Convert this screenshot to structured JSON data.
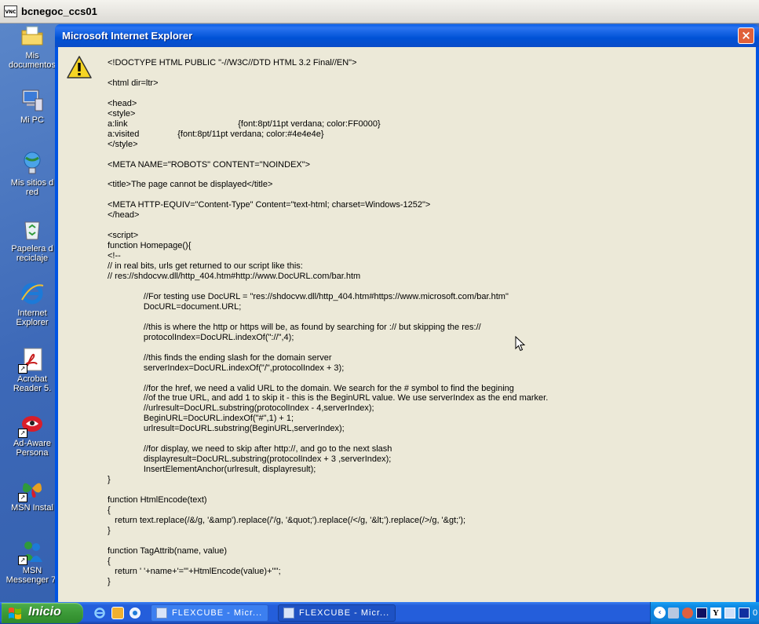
{
  "vnc": {
    "title": "bcnegoc_ccs01",
    "icon_text": "VNC"
  },
  "desktop": {
    "icons": [
      {
        "label": "Mis\ndocumentos",
        "icon": "folder-documents-icon"
      },
      {
        "label": "Mi PC",
        "icon": "computer-icon"
      },
      {
        "label": "Mis sitios d\nred",
        "icon": "network-places-icon"
      },
      {
        "label": "Papelera d\nreciclaje",
        "icon": "recycle-bin-icon"
      },
      {
        "label": "Internet\nExplorer",
        "icon": "internet-explorer-icon"
      },
      {
        "label": "Acrobat\nReader 5.",
        "icon": "acrobat-icon"
      },
      {
        "label": "Ad-Aware\nPersona",
        "icon": "ad-aware-icon"
      },
      {
        "label": "MSN Instal",
        "icon": "msn-butterfly-icon"
      },
      {
        "label": "MSN\nMessenger 7.",
        "icon": "msn-messenger-icon"
      }
    ]
  },
  "dialog": {
    "title": "Microsoft Internet Explorer",
    "close_symbol": "×",
    "icon": "warning-icon",
    "message": "<!DOCTYPE HTML PUBLIC \"-//W3C//DTD HTML 3.2 Final//EN\">\n\n<html dir=ltr>\n\n<head>\n<style>\na:link                                              {font:8pt/11pt verdana; color:FF0000}\na:visited                {font:8pt/11pt verdana; color:#4e4e4e}\n</style>\n\n<META NAME=\"ROBOTS\" CONTENT=\"NOINDEX\">\n\n<title>The page cannot be displayed</title>\n\n<META HTTP-EQUIV=\"Content-Type\" Content=\"text-html; charset=Windows-1252\">\n</head>\n\n<script>\nfunction Homepage(){\n<!--\n// in real bits, urls get returned to our script like this:\n// res://shdocvw.dll/http_404.htm#http://www.DocURL.com/bar.htm\n\n               //For testing use DocURL = \"res://shdocvw.dll/http_404.htm#https://www.microsoft.com/bar.htm\"\n               DocURL=document.URL;\n\n               //this is where the http or https will be, as found by searching for :// but skipping the res://\n               protocolIndex=DocURL.indexOf(\"://\",4);\n\n               //this finds the ending slash for the domain server\n               serverIndex=DocURL.indexOf(\"/\",protocolIndex + 3);\n\n               //for the href, we need a valid URL to the domain. We search for the # symbol to find the begining\n               //of the true URL, and add 1 to skip it - this is the BeginURL value. We use serverIndex as the end marker.\n               //urlresult=DocURL.substring(protocolIndex - 4,serverIndex);\n               BeginURL=DocURL.indexOf(\"#\",1) + 1;\n               urlresult=DocURL.substring(BeginURL,serverIndex);\n\n               //for display, we need to skip after http://, and go to the next slash\n               displayresult=DocURL.substring(protocolIndex + 3 ,serverIndex);\n               InsertElementAnchor(urlresult, displayresult);\n}\n\nfunction HtmlEncode(text)\n{\n   return text.replace(/&/g, '&amp').replace(/'/g, '&quot;').replace(/</g, '&lt;').replace(/>/g, '&gt;');\n}\n\nfunction TagAttrib(name, value)\n{\n   return ' '+name+'=\"'+HtmlEncode(value)+'\"';\n}"
  },
  "taskbar": {
    "start_label": "Inicio",
    "quick_launch": [
      "ie-quicklaunch-icon",
      "outlook-quicklaunch-icon",
      "media-quicklaunch-icon"
    ],
    "tasks": [
      {
        "label": "FLEXCUBE - Micr...",
        "active": false
      },
      {
        "label": "FLEXCUBE - Micr...",
        "active": true
      }
    ],
    "tray_arrow": "‹",
    "clock_fragment": "0"
  },
  "colors": {
    "xp_blue": "#0054e3",
    "dialog_bg": "#ece9d8",
    "start_green": "#3c9a38",
    "tray_blue": "#0f7fd8",
    "close_red": "#e0603a"
  }
}
